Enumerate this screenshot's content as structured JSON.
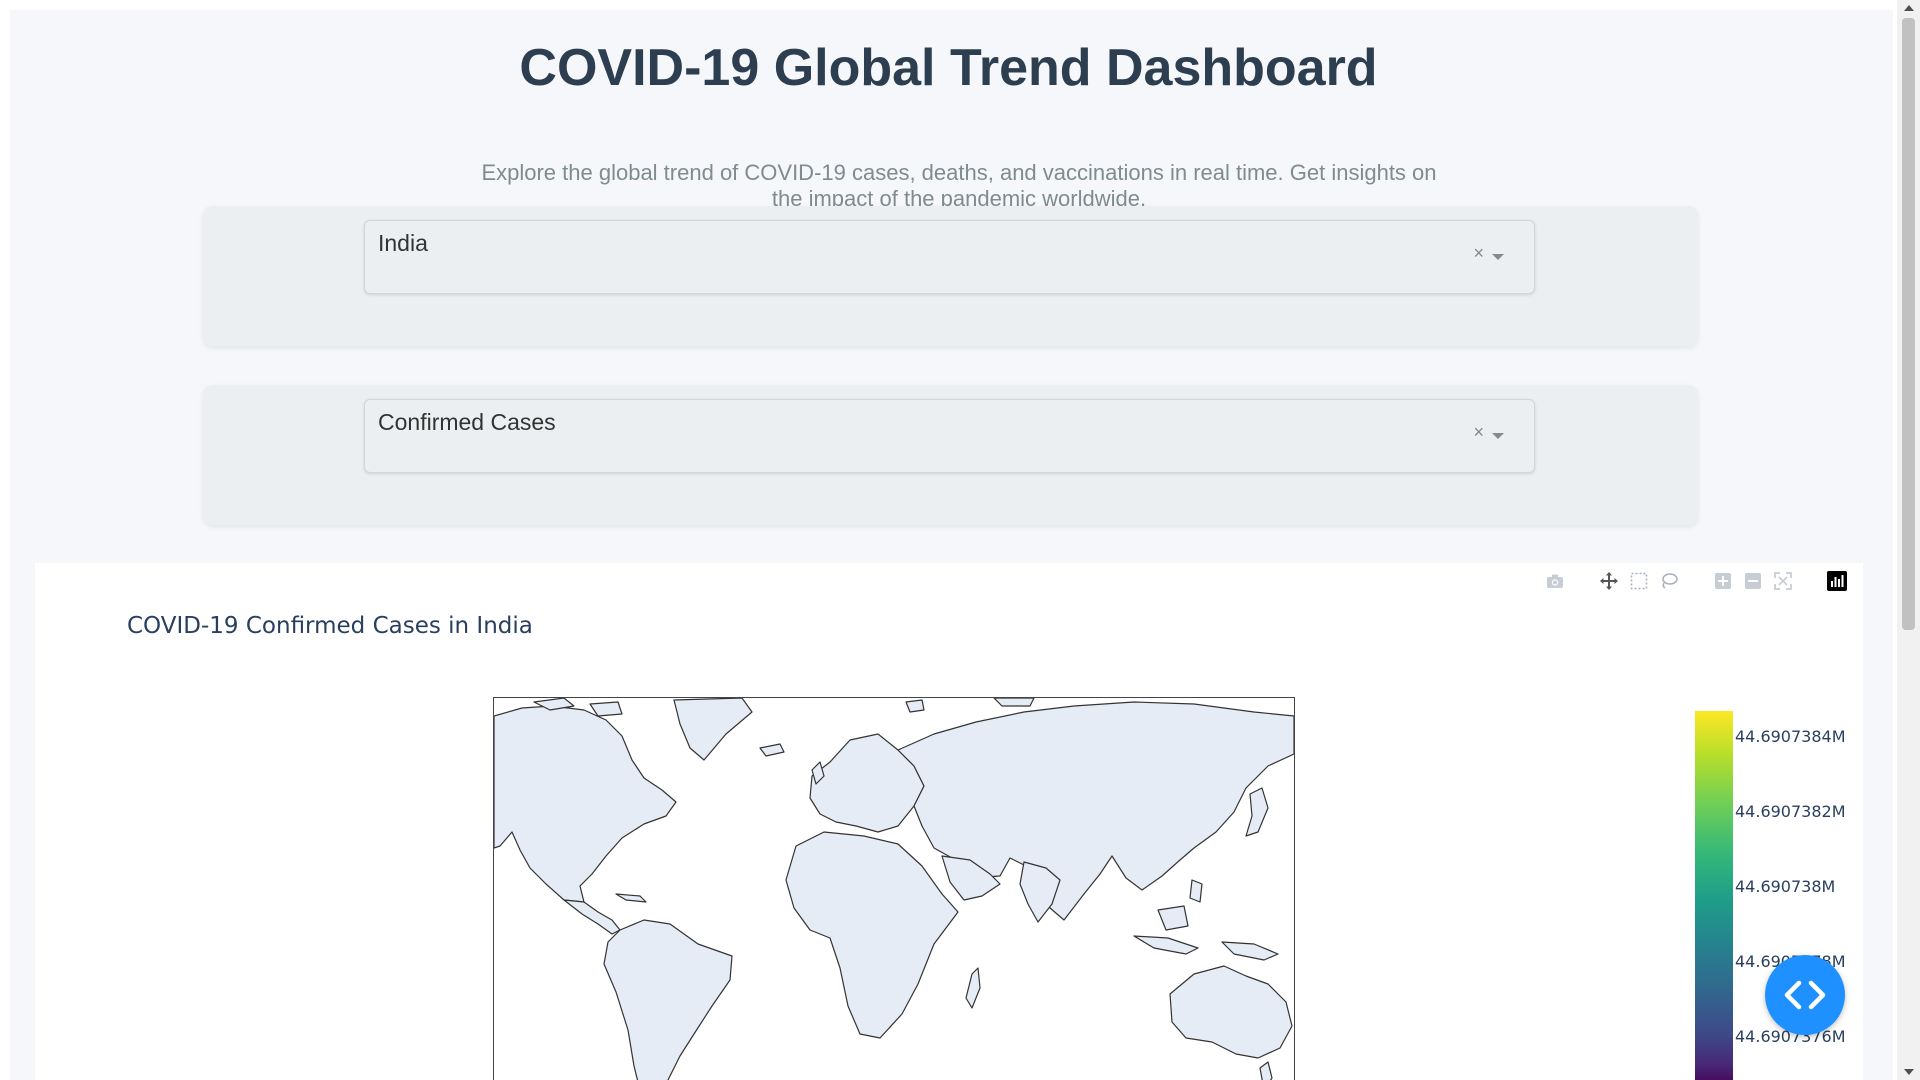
{
  "header": {
    "title": "COVID-19 Global Trend Dashboard",
    "subtitle_line1": "Explore the global trend of COVID-19 cases, deaths, and vaccinations in real time. Get insights on",
    "subtitle_line2": "the impact of the pandemic worldwide."
  },
  "controls": {
    "country_dropdown": {
      "value": "India",
      "clear_glyph": "×"
    },
    "metric_dropdown": {
      "value": "Confirmed Cases",
      "clear_glyph": "×"
    }
  },
  "chart_toolbar": {
    "icons": [
      "camera-icon",
      "pan-icon",
      "box-select-icon",
      "lasso-icon",
      "zoom-in-icon",
      "zoom-out-icon",
      "autoscale-icon",
      "plotly-logo-icon"
    ]
  },
  "chart_data": {
    "type": "choropleth",
    "title": "COVID-19 Confirmed Cases in India",
    "locations": [
      "India"
    ],
    "values": [
      44690738
    ],
    "colorscale": "Viridis",
    "colorbar_ticks": [
      "44.6907384M",
      "44.6907382M",
      "44.690738M",
      "44.6907378M",
      "44.6907376M"
    ],
    "projection": "equirectangular"
  },
  "colors": {
    "title": "#2c3e50",
    "subtitle": "#7f8c8d",
    "land": "#e5ecf6",
    "fab": "#1e90ff"
  },
  "floating_button": {
    "icon": "code-icon"
  }
}
